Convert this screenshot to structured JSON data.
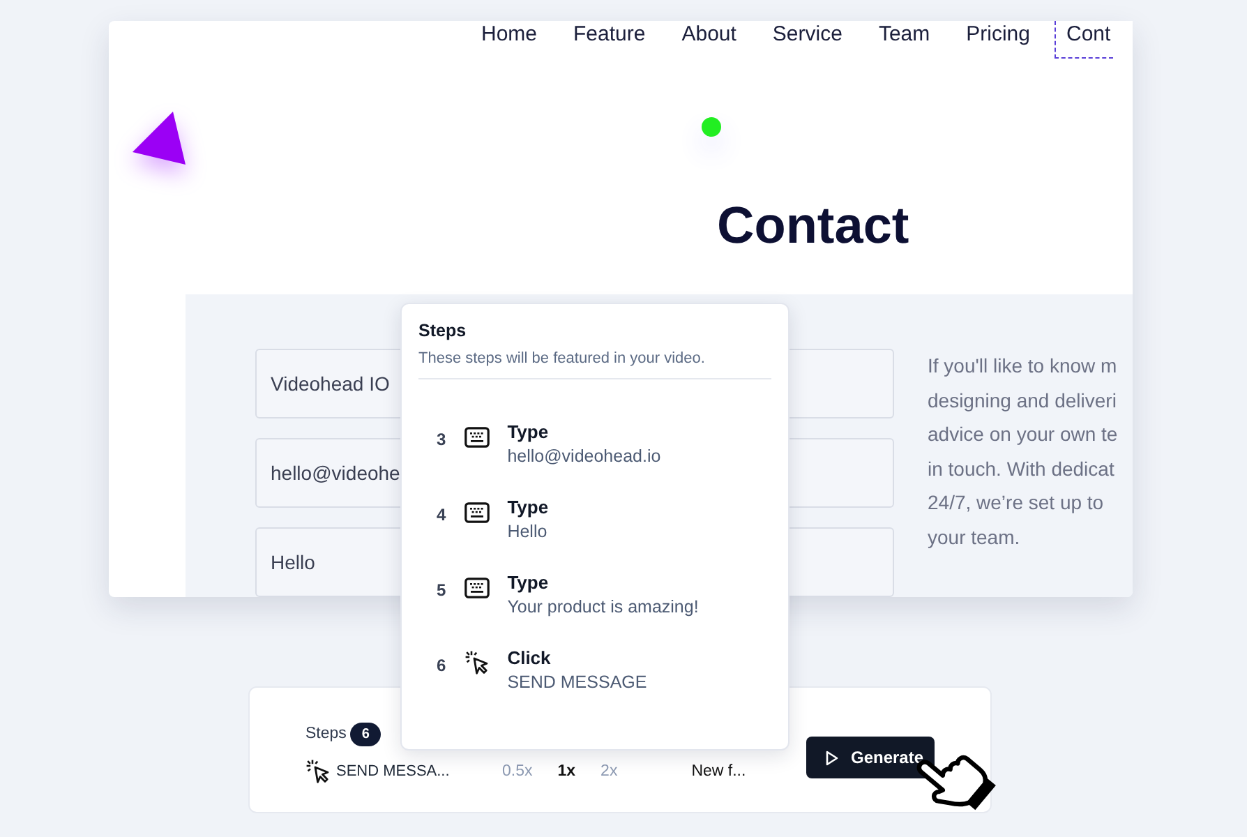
{
  "website_preview": {
    "nav": [
      {
        "label": "Home",
        "selected": false
      },
      {
        "label": "Feature",
        "selected": false
      },
      {
        "label": "About",
        "selected": false
      },
      {
        "label": "Service",
        "selected": false
      },
      {
        "label": "Team",
        "selected": false
      },
      {
        "label": "Pricing",
        "selected": false
      },
      {
        "label": "Cont",
        "selected": true
      }
    ],
    "heading": "Contact",
    "form_fields": [
      {
        "value": "Videohead IO"
      },
      {
        "value": "hello@videohe"
      },
      {
        "value": "Hello"
      }
    ],
    "paragraph_lines": [
      "If you'll like to know m",
      "designing and deliveri",
      "advice on your own te",
      "in touch. With dedicat",
      "24/7, we’re set up to",
      "your team."
    ]
  },
  "steps_popup": {
    "title": "Steps",
    "subtitle": "These steps will be featured in your video.",
    "steps": [
      {
        "number": "3",
        "kind": "type",
        "action": "Type",
        "value": "hello@videohead.io"
      },
      {
        "number": "4",
        "kind": "type",
        "action": "Type",
        "value": "Hello"
      },
      {
        "number": "5",
        "kind": "type",
        "action": "Type",
        "value": "Your product is amazing!"
      },
      {
        "number": "6",
        "kind": "click",
        "action": "Click",
        "value": "SEND MESSAGE"
      }
    ]
  },
  "bottom_bar": {
    "steps_label": "Steps",
    "steps_count": "6",
    "current_step": {
      "kind": "click",
      "label": "SEND MESSA..."
    },
    "speeds": [
      {
        "label": "0.5x",
        "selected": false
      },
      {
        "label": "1x",
        "selected": true
      },
      {
        "label": "2x",
        "selected": false
      }
    ],
    "item_label": "New f...",
    "generate_button": "Generate"
  }
}
